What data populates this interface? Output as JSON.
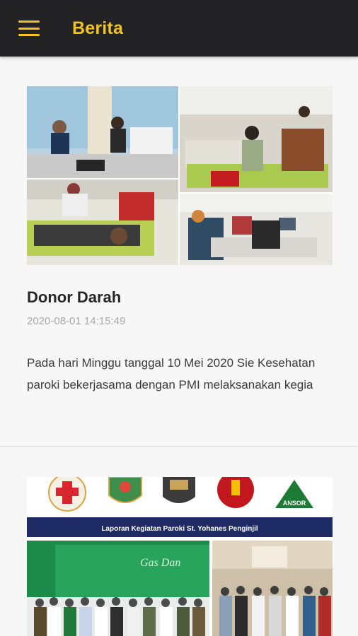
{
  "app_bar": {
    "title": "Berita",
    "menu_icon": "hamburger-menu-icon",
    "accent_color": "#f3c325",
    "background_color": "#232325"
  },
  "news": [
    {
      "title": "Donor Darah",
      "date": "2020-08-01 14:15:49",
      "excerpt": "Pada hari Minggu tanggal 10 Mei 2020 Sie Kesehatan paroki bekerjasama dengan PMI melaksanakan kegia"
    },
    {
      "banner_caption": "Laporan Kegiatan Paroki St. Yohanes Penginjil",
      "logo_ansor_text": "ANSOR",
      "backdrop_text": "Gas Dan"
    }
  ]
}
